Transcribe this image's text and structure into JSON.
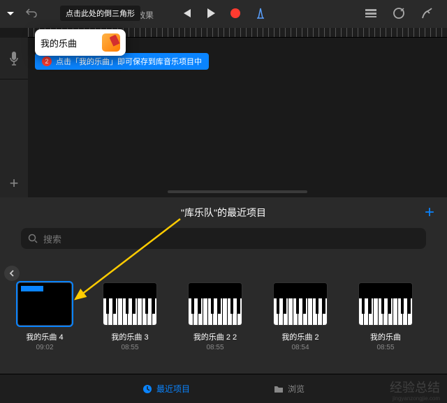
{
  "toolbar": {
    "callout_triangle": "点击此处的倒三角形",
    "fx_label": "效果"
  },
  "popup": {
    "title": "我的乐曲",
    "callout_save": "点击「我的乐曲」即可保存到库音乐项目中",
    "badge": "2"
  },
  "browser": {
    "title": "\"库乐队\"的最近项目",
    "search_placeholder": "搜索",
    "add_label": "+",
    "tabs": {
      "recent": "最近项目",
      "browse": "浏览"
    }
  },
  "projects": [
    {
      "name": "我的乐曲 4",
      "time": "09:02",
      "selected": true,
      "blank": true
    },
    {
      "name": "我的乐曲 3",
      "time": "08:55",
      "selected": false,
      "blank": false
    },
    {
      "name": "我的乐曲 2 2",
      "time": "08:55",
      "selected": false,
      "blank": false
    },
    {
      "name": "我的乐曲 2",
      "time": "08:54",
      "selected": false,
      "blank": false
    },
    {
      "name": "我的乐曲",
      "time": "08:55",
      "selected": false,
      "blank": false
    }
  ],
  "watermark": {
    "main": "经验总结",
    "sub": "jingyanzongjie.com"
  }
}
